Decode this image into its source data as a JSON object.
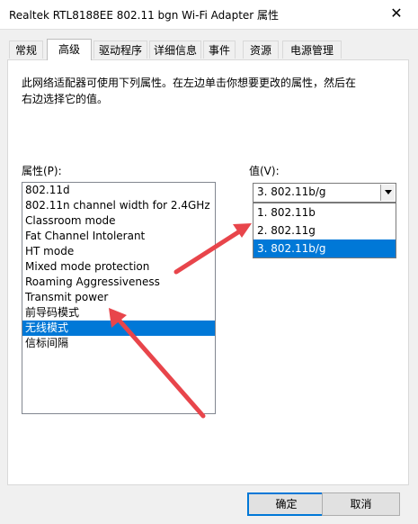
{
  "window": {
    "title": "Realtek RTL8188EE 802.11 bgn Wi-Fi Adapter 属性",
    "close_glyph": "✕"
  },
  "tabs": [
    {
      "label": "常规",
      "active": false
    },
    {
      "label": "高级",
      "active": true
    },
    {
      "label": "驱动程序",
      "active": false
    },
    {
      "label": "详细信息",
      "active": false
    },
    {
      "label": "事件",
      "active": false
    },
    {
      "label": "资源",
      "active": false
    },
    {
      "label": "电源管理",
      "active": false
    }
  ],
  "advanced": {
    "description": "此网络适配器可使用下列属性。在左边单击你想要更改的属性，然后在右边选择它的值。",
    "property_label": "属性(P):",
    "value_label": "值(V):",
    "properties": [
      "802.11d",
      "802.11n channel width for 2.4GHz",
      "Classroom mode",
      "Fat Channel Intolerant",
      "HT mode",
      "Mixed mode protection",
      "Roaming Aggressiveness",
      "Transmit power",
      "前导码模式",
      "无线模式",
      "信标间隔"
    ],
    "selected_property": "无线模式",
    "value_selected": "3. 802.11b/g",
    "value_options": [
      "1. 802.11b",
      "2. 802.11g",
      "3. 802.11b/g"
    ]
  },
  "buttons": {
    "ok": "确定",
    "cancel": "取消"
  },
  "colors": {
    "selection": "#0078d7",
    "annotation_arrow": "#e8454b"
  }
}
